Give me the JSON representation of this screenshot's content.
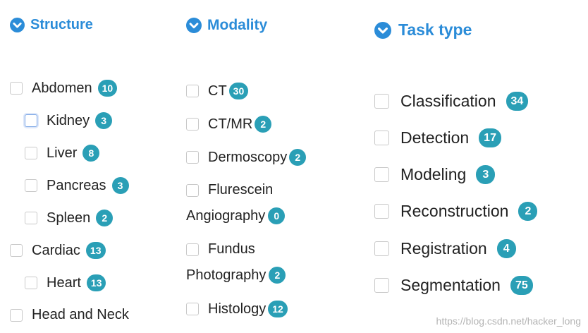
{
  "headers": {
    "structure": "Structure",
    "modality": "Modality",
    "task_type": "Task type"
  },
  "structure": {
    "abdomen": {
      "label": "Abdomen",
      "count": "10"
    },
    "kidney": {
      "label": "Kidney",
      "count": "3"
    },
    "liver": {
      "label": "Liver",
      "count": "8"
    },
    "pancreas": {
      "label": "Pancreas",
      "count": "3"
    },
    "spleen": {
      "label": "Spleen",
      "count": "2"
    },
    "cardiac": {
      "label": "Cardiac",
      "count": "13"
    },
    "heart": {
      "label": "Heart",
      "count": "13"
    },
    "head_and_neck": {
      "label": "Head and Neck"
    }
  },
  "modality": {
    "ct": {
      "label": "CT",
      "count": "30"
    },
    "ct_mr": {
      "label": "CT/MR",
      "count": "2"
    },
    "dermoscopy": {
      "label": "Dermoscopy",
      "count": "2"
    },
    "fluorescein": {
      "label_line1": "Flurescein",
      "label_line2": "Angiography",
      "count": "0"
    },
    "fundus": {
      "label_line1": "Fundus",
      "label_line2": "Photography",
      "count": "2"
    },
    "histology": {
      "label": "Histology",
      "count": "12"
    }
  },
  "task_type": {
    "classification": {
      "label": "Classification",
      "count": "34"
    },
    "detection": {
      "label": "Detection",
      "count": "17"
    },
    "modeling": {
      "label": "Modeling",
      "count": "3"
    },
    "reconstruction": {
      "label": "Reconstruction",
      "count": "2"
    },
    "registration": {
      "label": "Registration",
      "count": "4"
    },
    "segmentation": {
      "label": "Segmentation",
      "count": "75"
    }
  },
  "watermark": "https://blog.csdn.net/hacker_long",
  "colors": {
    "accent": "#2b8cd8",
    "badge": "#2a9fb6"
  },
  "icons": {
    "section_toggle": "chevron-down-circle-icon"
  }
}
